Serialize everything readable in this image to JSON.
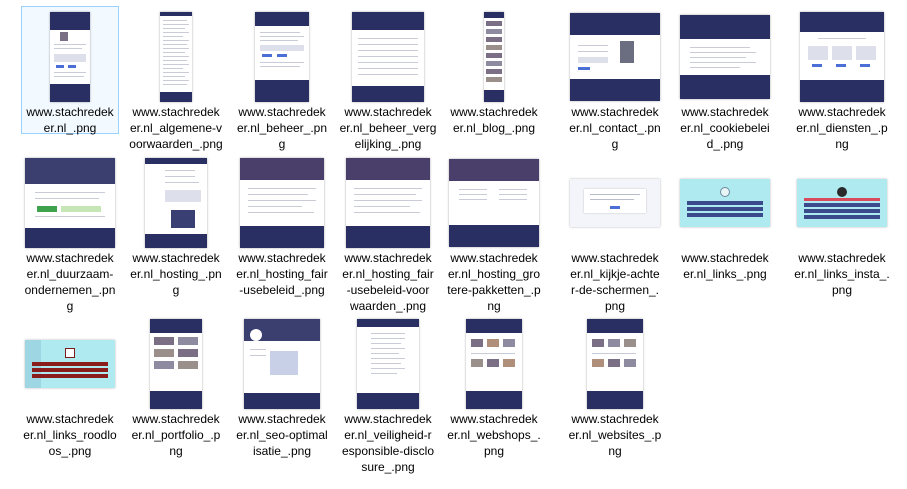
{
  "files": [
    {
      "name": "www.stachredeker.nl_.png"
    },
    {
      "name": "www.stachredeker.nl_algemene-voorwaarden_.png"
    },
    {
      "name": "www.stachredeker.nl_beheer_.png"
    },
    {
      "name": "www.stachredeker.nl_beheer_vergelijking_.png"
    },
    {
      "name": "www.stachredeker.nl_blog_.png"
    },
    {
      "name": "www.stachredeker.nl_contact_.png"
    },
    {
      "name": "www.stachredeker.nl_cookiebeleid_.png"
    },
    {
      "name": "www.stachredeker.nl_diensten_.png"
    },
    {
      "name": "www.stachredeker.nl_duurzaam-ondernemen_.png"
    },
    {
      "name": "www.stachredeker.nl_hosting_.png"
    },
    {
      "name": "www.stachredeker.nl_hosting_fair-usebeleid_.png"
    },
    {
      "name": "www.stachredeker.nl_hosting_fair-usebeleid-voorwaarden_.png"
    },
    {
      "name": "www.stachredeker.nl_hosting_grotere-pakketten_.png"
    },
    {
      "name": "www.stachredeker.nl_kijkje-achter-de-schermen_.png"
    },
    {
      "name": "www.stachredeker.nl_links_.png"
    },
    {
      "name": "www.stachredeker.nl_links_insta_.png"
    },
    {
      "name": "www.stachredeker.nl_links_roodloos_.png"
    },
    {
      "name": "www.stachredeker.nl_portfolio_.png"
    },
    {
      "name": "www.stachredeker.nl_seo-optimalisatie_.png"
    },
    {
      "name": "www.stachredeker.nl_veiligheid-responsible-disclosure_.png"
    },
    {
      "name": "www.stachredeker.nl_webshops_.png"
    },
    {
      "name": "www.stachredeker.nl_websites_.png"
    }
  ],
  "labels": [
    [
      "www.stachredek",
      "er.nl_.png"
    ],
    [
      "www.stachredek",
      "er.nl_algemene-v",
      "oorwaarden_.png"
    ],
    [
      "www.stachredek",
      "er.nl_beheer_.pn",
      "g"
    ],
    [
      "www.stachredek",
      "er.nl_beheer_verg",
      "elijking_.png"
    ],
    [
      "www.stachredek",
      "er.nl_blog_.png"
    ],
    [
      "www.stachredek",
      "er.nl_contact_.pn",
      "g"
    ],
    [
      "www.stachredek",
      "er.nl_cookiebelei",
      "d_.png"
    ],
    [
      "www.stachredek",
      "er.nl_diensten_.p",
      "ng"
    ],
    [
      "www.stachredek",
      "er.nl_duurzaam-",
      "ondernemen_.pn",
      "g"
    ],
    [
      "www.stachredek",
      "er.nl_hosting_.pn",
      "g"
    ],
    [
      "www.stachredek",
      "er.nl_hosting_fair",
      "-usebeleid_.png"
    ],
    [
      "www.stachredek",
      "er.nl_hosting_fair",
      "-usebeleid-voor",
      "waarden_.png"
    ],
    [
      "www.stachredek",
      "er.nl_hosting_gro",
      "tere-pakketten_.p",
      "ng"
    ],
    [
      "www.stachredek",
      "er.nl_kijkje-achte",
      "r-de-schermen_.",
      "png"
    ],
    [
      "www.stachredek",
      "er.nl_links_.png"
    ],
    [
      "www.stachredek",
      "er.nl_links_insta_.",
      "png"
    ],
    [
      "www.stachredek",
      "er.nl_links_roodlo",
      "os_.png"
    ],
    [
      "www.stachredek",
      "er.nl_portfolio_.p",
      "ng"
    ],
    [
      "www.stachredek",
      "er.nl_seo-optimal",
      "isatie_.png"
    ],
    [
      "www.stachredek",
      "er.nl_veiligheid-r",
      "esponsible-disclo",
      "sure_.png"
    ],
    [
      "www.stachredek",
      "er.nl_webshops_.",
      "png"
    ],
    [
      "www.stachredek",
      "er.nl_websites_.p",
      "ng"
    ]
  ],
  "selected_index": 0,
  "colors": {
    "selection_border": "#99d1ff",
    "site_navy": "#2a2f63",
    "banner_cyan": "#aeeaf0",
    "banner_light": "#f4f5fa",
    "accent_red": "#d94b5c"
  }
}
